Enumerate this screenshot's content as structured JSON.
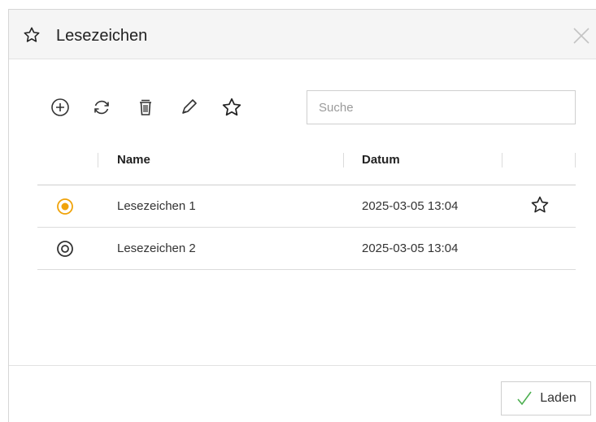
{
  "dialog": {
    "title": "Lesezeichen",
    "icons": {
      "title": "star-outline-icon",
      "close": "close-icon"
    }
  },
  "toolbar": {
    "buttons": [
      {
        "id": "add",
        "icon": "plus-circle-icon"
      },
      {
        "id": "refresh",
        "icon": "refresh-icon"
      },
      {
        "id": "delete",
        "icon": "trash-icon"
      },
      {
        "id": "edit",
        "icon": "pencil-icon"
      },
      {
        "id": "favorite",
        "icon": "star-outline-icon"
      }
    ],
    "search_placeholder": "Suche",
    "search_value": ""
  },
  "table": {
    "columns": [
      "Name",
      "Datum"
    ],
    "rows": [
      {
        "name": "Lesezeichen 1",
        "date": "2025-03-05 13:04",
        "selected": true,
        "favorite": true
      },
      {
        "name": "Lesezeichen 2",
        "date": "2025-03-05 13:04",
        "selected": false,
        "favorite": false
      }
    ]
  },
  "footer": {
    "load_label": "Laden",
    "load_icon": "checkmark-icon"
  },
  "colors": {
    "accent": "#f0a30a",
    "check": "#4caf50",
    "titlebar_bg": "#f5f5f5"
  }
}
